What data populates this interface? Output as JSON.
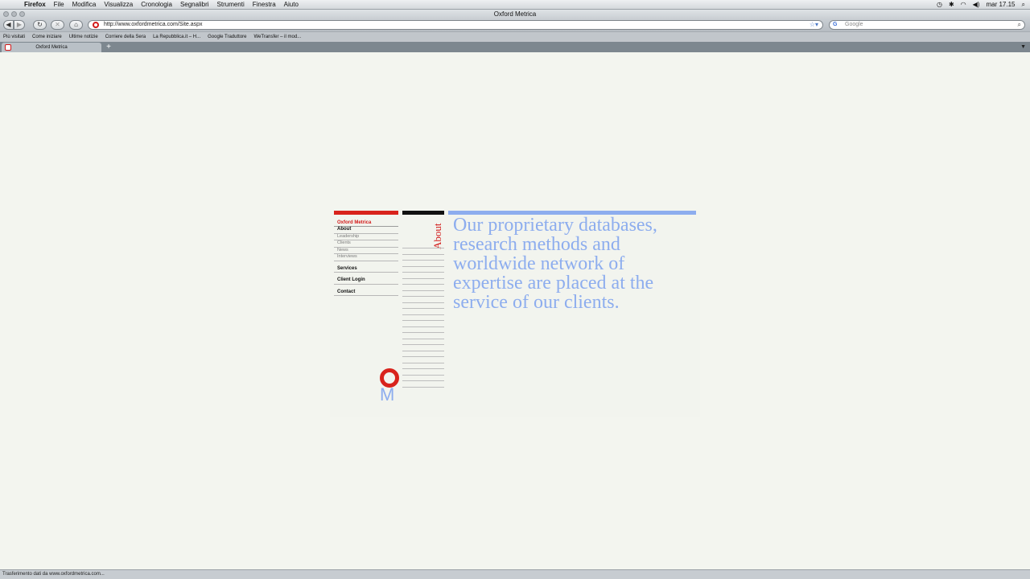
{
  "menubar": {
    "app_name": "Firefox",
    "items": [
      "File",
      "Modifica",
      "Visualizza",
      "Cronologia",
      "Segnalibri",
      "Strumenti",
      "Finestra",
      "Aiuto"
    ],
    "clock": "mar 17.15"
  },
  "window": {
    "title": "Oxford Metrica"
  },
  "toolbar": {
    "url": "http://www.oxfordmetrica.com/Site.aspx",
    "search_placeholder": "Google"
  },
  "bookmarks": [
    "Più visitati",
    "Come iniziare",
    "Ultime notizie",
    "Corriere della Sera",
    "La Repubblica.it – H...",
    "Google Traduttore",
    "WeTransfer – il mod..."
  ],
  "tabs": [
    {
      "label": "Oxford Metrica"
    }
  ],
  "site": {
    "brand": "Oxford Metrica",
    "nav": {
      "about": "About",
      "sub": [
        "Leadership",
        "Clients",
        "News",
        "Interviews"
      ],
      "services": "Services",
      "client_login": "Client Login",
      "contact": "Contact"
    },
    "section_title": "About",
    "logo_letter": "M",
    "headline": "Our proprietary databases, research methods and worldwide network of expertise are placed at the service of our clients."
  },
  "status": {
    "text": "Trasferimento dati da www.oxfordmetrica.com..."
  },
  "colors": {
    "brand_red": "#d8231c",
    "accent_blue": "#8dadee",
    "background": "#f3f5ef"
  }
}
